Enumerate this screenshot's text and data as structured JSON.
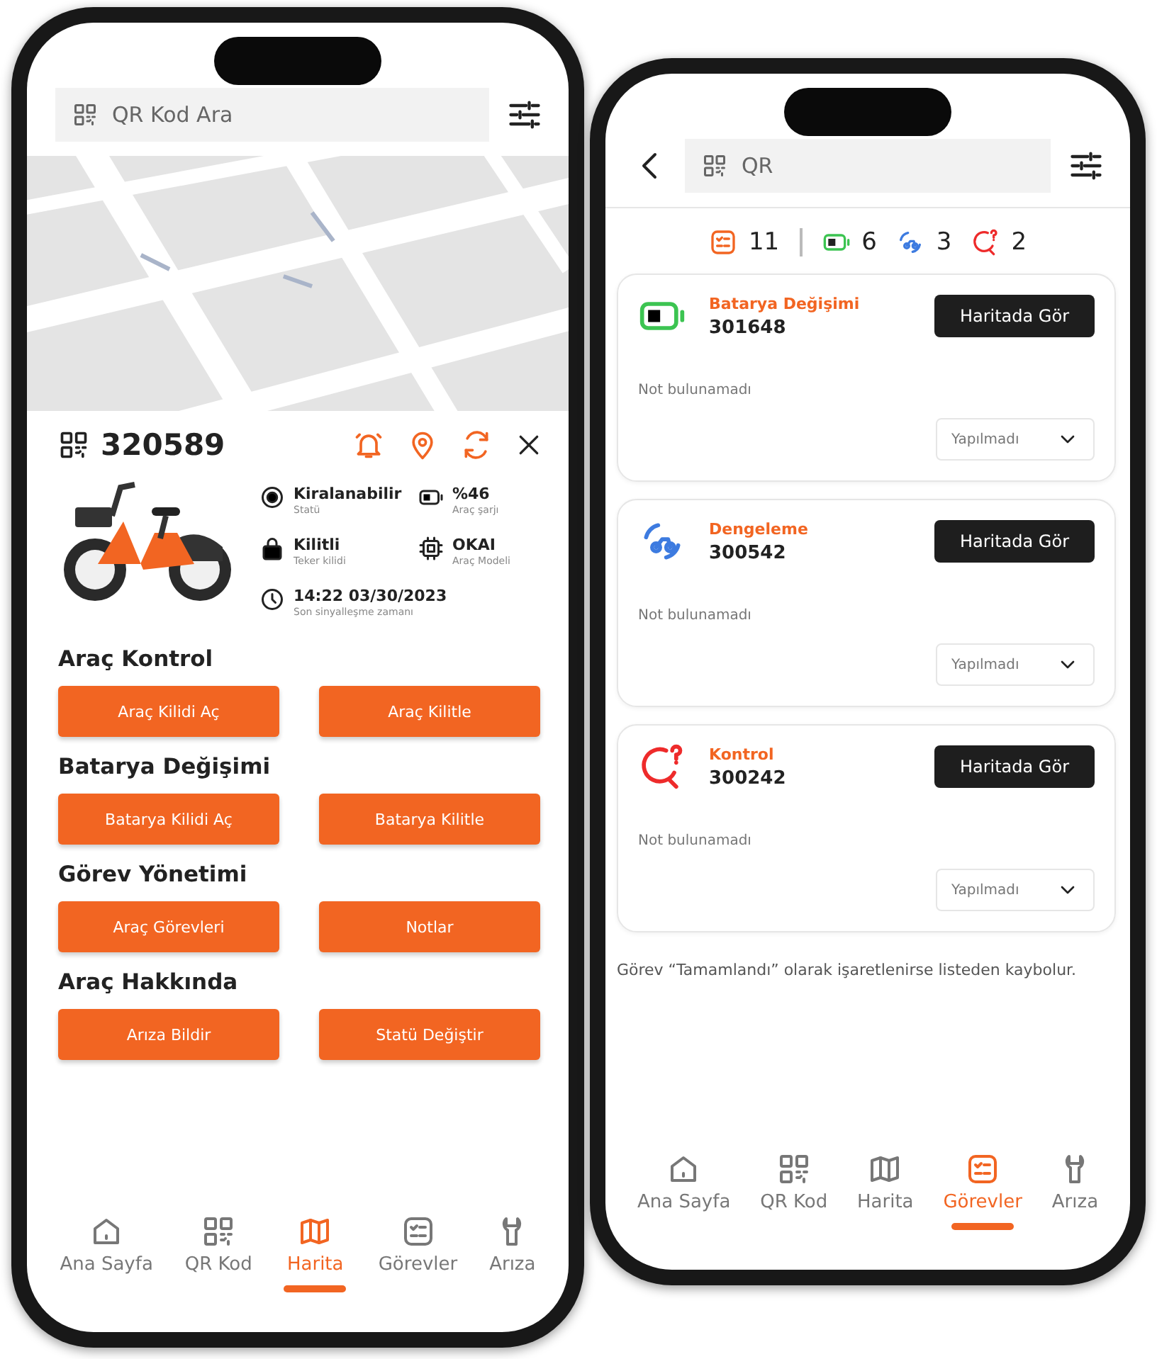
{
  "left_phone": {
    "search": {
      "value": "QR Kod Ara"
    },
    "vehicle": {
      "id": "320589",
      "info": [
        {
          "kind": "status",
          "value": "Kiralanabilir",
          "caption": "Statü"
        },
        {
          "kind": "battery",
          "value": "%46",
          "caption": "Araç şarjı"
        },
        {
          "kind": "lock",
          "value": "Kilitli",
          "caption": "Teker kilidi"
        },
        {
          "kind": "chip",
          "value": "OKAI",
          "caption": "Araç Modeli"
        },
        {
          "kind": "clock",
          "value": "14:22 03/30/2023",
          "caption": "Son sinyalleşme zamanı"
        }
      ]
    },
    "sections": [
      {
        "title": "Araç Kontrol",
        "buttons": [
          "Araç Kilidi Aç",
          "Araç Kilitle"
        ]
      },
      {
        "title": "Batarya Değişimi",
        "buttons": [
          "Batarya Kilidi Aç",
          "Batarya Kilitle"
        ]
      },
      {
        "title": "Görev Yönetimi",
        "buttons": [
          "Araç Görevleri",
          "Notlar"
        ]
      },
      {
        "title": "Araç Hakkında",
        "buttons": [
          "Arıza Bildir",
          "Statü Değiştir"
        ]
      }
    ],
    "nav": [
      {
        "kind": "home",
        "label": "Ana Sayfa",
        "selected": false
      },
      {
        "kind": "qr",
        "label": "QR Kod",
        "selected": false
      },
      {
        "kind": "map",
        "label": "Harita",
        "selected": true
      },
      {
        "kind": "tasks",
        "label": "Görevler",
        "selected": false
      },
      {
        "kind": "wrench",
        "label": "Arıza",
        "selected": false
      }
    ]
  },
  "right_phone": {
    "search": {
      "value": "QR"
    },
    "counts": [
      {
        "kind": "tasks",
        "value": "11",
        "color": "#f26522"
      },
      {
        "kind": "battery",
        "value": "6",
        "color": "#3cc451"
      },
      {
        "kind": "balance",
        "value": "3",
        "color": "#3d7be0"
      },
      {
        "kind": "check",
        "value": "2",
        "color": "#ee2b2b"
      }
    ],
    "tasks": [
      {
        "kind": "battery",
        "title": "Batarya Değişimi",
        "id": "301648",
        "button": "Haritada Gör",
        "note": "Not bulunamadı",
        "status": "Yapılmadı"
      },
      {
        "kind": "balance",
        "title": "Dengeleme",
        "id": "300542",
        "button": "Haritada Gör",
        "note": "Not bulunamadı",
        "status": "Yapılmadı"
      },
      {
        "kind": "check",
        "title": "Kontrol",
        "id": "300242",
        "button": "Haritada Gör",
        "note": "Not bulunamadı",
        "status": "Yapılmadı"
      }
    ],
    "footer_note": "Görev “Tamamlandı” olarak işaretlenirse listeden  kaybolur.",
    "nav": [
      {
        "kind": "home",
        "label": "Ana Sayfa",
        "selected": false
      },
      {
        "kind": "qr",
        "label": "QR Kod",
        "selected": false
      },
      {
        "kind": "map",
        "label": "Harita",
        "selected": false
      },
      {
        "kind": "tasks",
        "label": "Görevler",
        "selected": true
      },
      {
        "kind": "wrench",
        "label": "Arıza",
        "selected": false
      }
    ]
  }
}
